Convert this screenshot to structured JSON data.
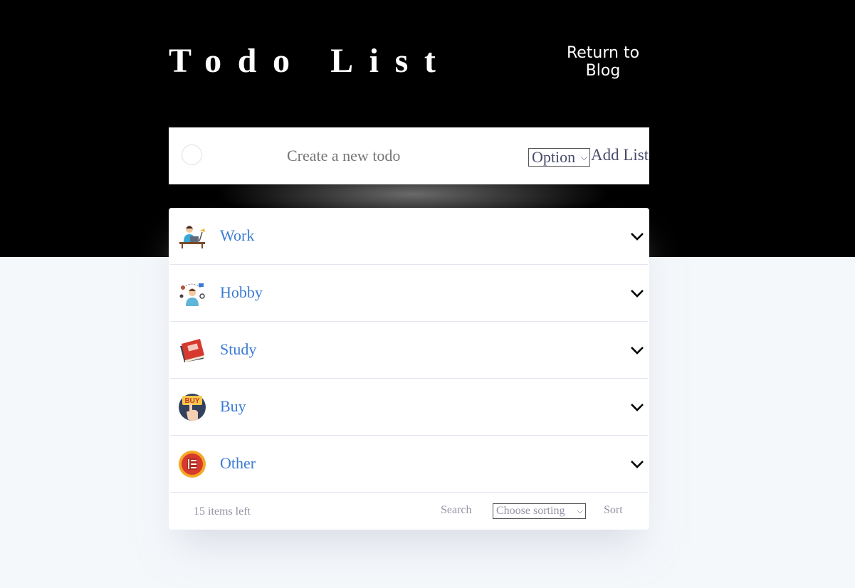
{
  "header": {
    "title": "Todo List",
    "return_link": "Return to Blog"
  },
  "create": {
    "placeholder": "Create a new todo",
    "option_select": "Option",
    "add_list_label": "Add List"
  },
  "categories": [
    {
      "label": "Work",
      "icon": "work-desk-icon"
    },
    {
      "label": "Hobby",
      "icon": "hobby-person-icon"
    },
    {
      "label": "Study",
      "icon": "book-icon"
    },
    {
      "label": "Buy",
      "icon": "buy-hand-icon"
    },
    {
      "label": "Other",
      "icon": "list-circle-icon"
    }
  ],
  "buy_icon_text": "BUY",
  "footer": {
    "items_left": "15 items left",
    "search_label": "Search",
    "sort_select": "Choose sorting",
    "sort_label": "Sort"
  },
  "colors": {
    "category_text": "#3a7bd5",
    "footer_text": "#9495a5",
    "hero_bg": "#000000",
    "page_bg": "#f5f8fb"
  }
}
